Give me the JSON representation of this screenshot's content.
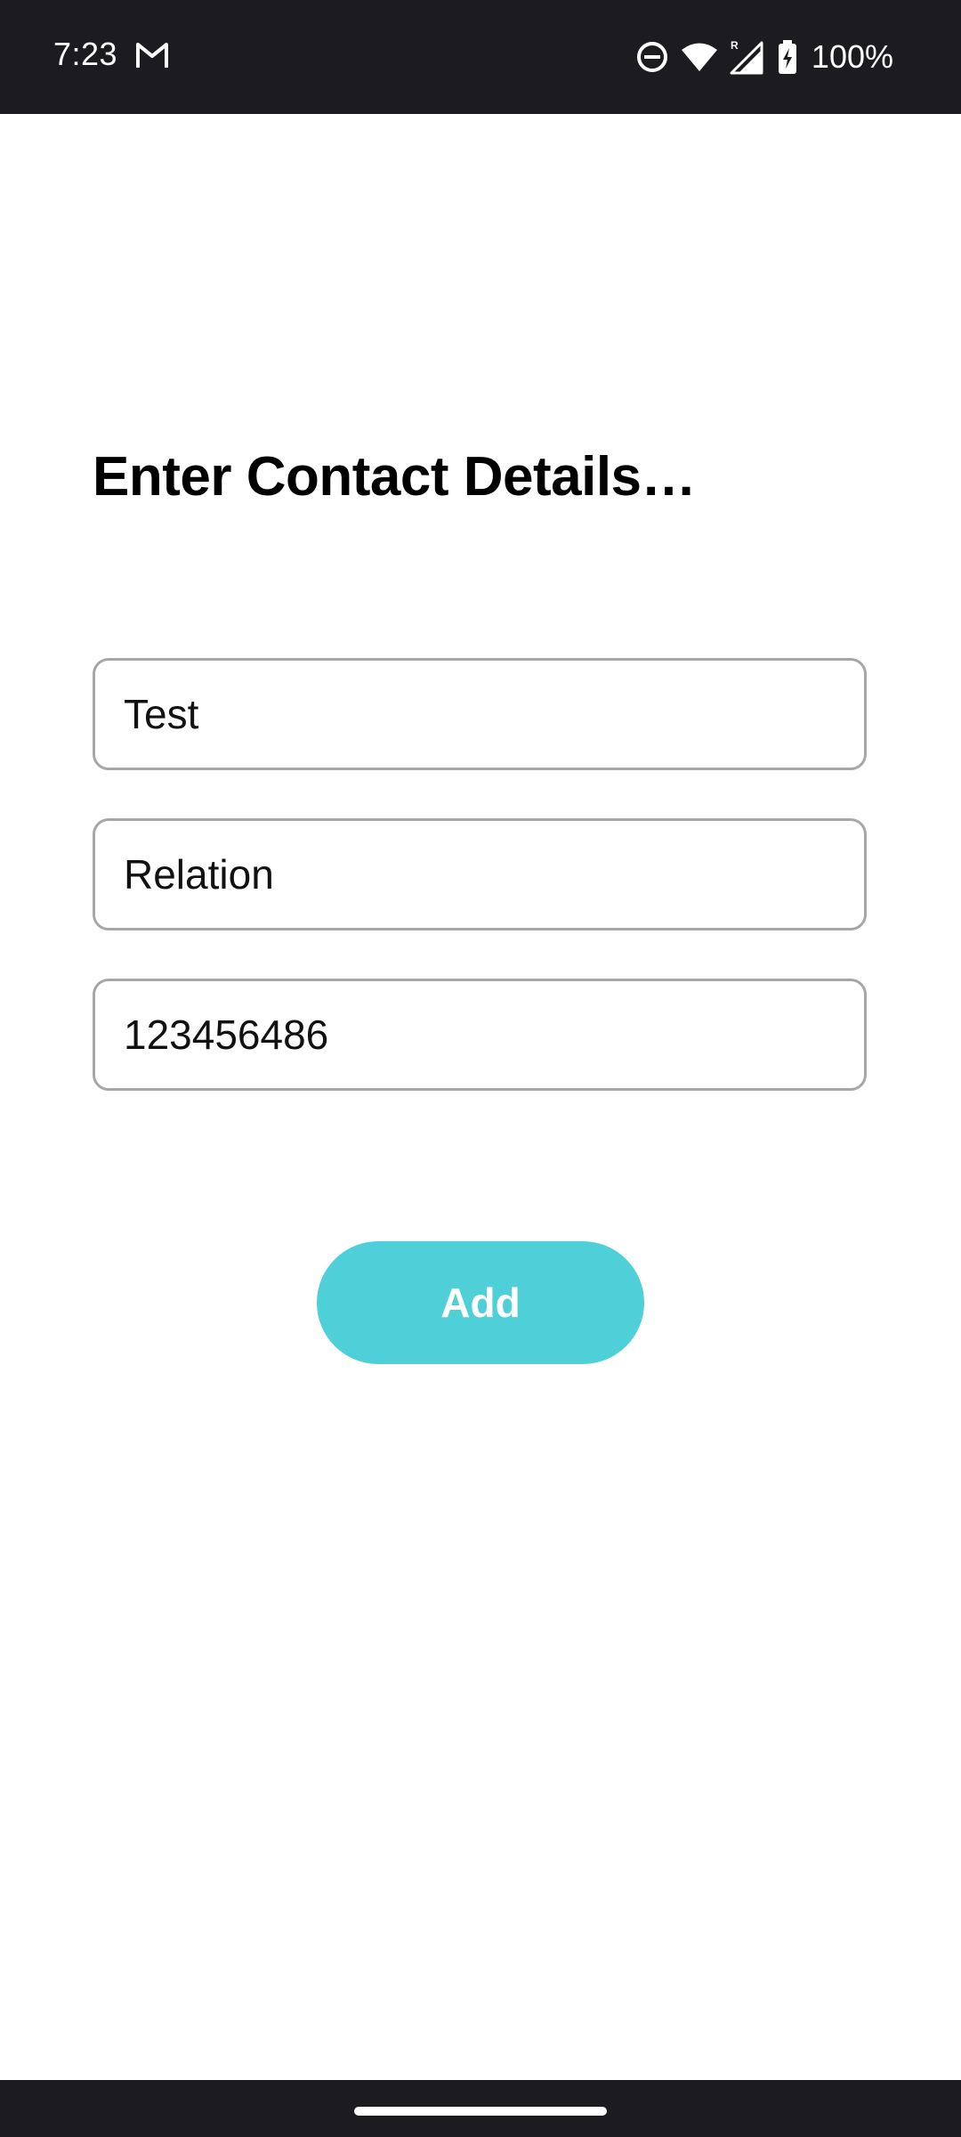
{
  "status_bar": {
    "time": "7:23",
    "notification_icon": "gmail-icon",
    "icons": [
      "do-not-disturb-icon",
      "wifi-icon",
      "cell-signal-roaming-icon",
      "battery-charging-icon"
    ],
    "roaming_indicator": "R",
    "battery_percent": "100%"
  },
  "form": {
    "title": "Enter Contact Details…",
    "name_value": "Test",
    "relation_placeholder": "Relation",
    "phone_value": "123456486",
    "add_button_label": "Add"
  },
  "colors": {
    "accent": "#4fd0d9",
    "system_bars": "#1c1b20",
    "field_border": "#a7a7a7"
  }
}
